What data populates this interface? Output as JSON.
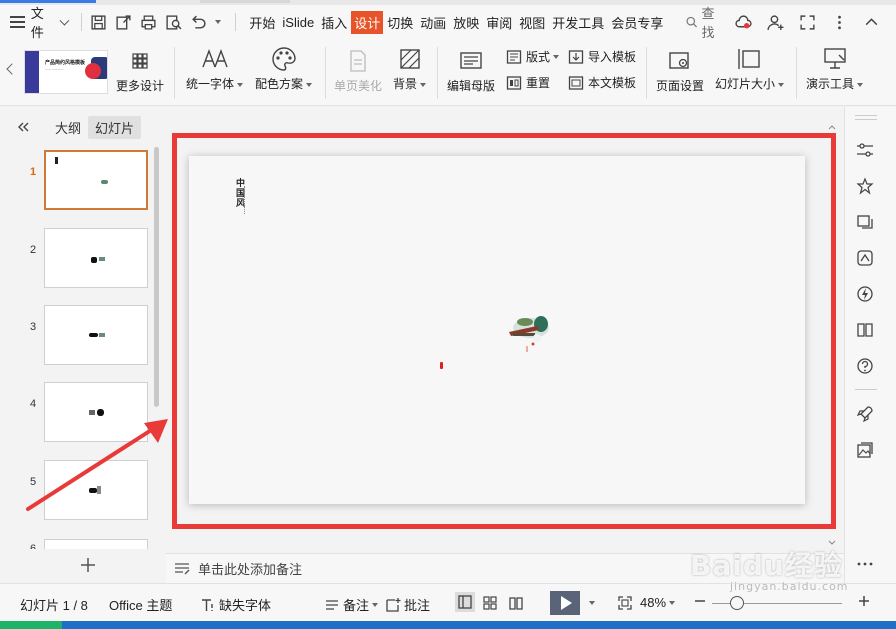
{
  "menu": {
    "file_label": "文件",
    "tabs": [
      {
        "label": "开始",
        "active": false
      },
      {
        "label": "iSlide",
        "active": false
      },
      {
        "label": "插入",
        "active": false
      },
      {
        "label": "设计",
        "active": true
      },
      {
        "label": "切换",
        "active": false
      },
      {
        "label": "动画",
        "active": false
      },
      {
        "label": "放映",
        "active": false
      },
      {
        "label": "审阅",
        "active": false
      },
      {
        "label": "视图",
        "active": false
      },
      {
        "label": "开发工具",
        "active": false
      },
      {
        "label": "会员专享",
        "active": false
      }
    ],
    "search_label": "查找"
  },
  "ribbon": {
    "design_thumb_title": "产品简约风格模板",
    "more_design": "更多设计",
    "unify_font": "统一字体",
    "color_scheme": "配色方案",
    "single_page_beautify": "单页美化",
    "background": "背景",
    "edit_master": "编辑母版",
    "layout": "版式",
    "reset": "重置",
    "import_template": "导入模板",
    "this_template": "本文模板",
    "page_setup": "页面设置",
    "slide_size": "幻灯片大小",
    "presenter_tools": "演示工具"
  },
  "left_panel": {
    "outline_tab": "大纲",
    "slides_tab": "幻灯片",
    "slides": [
      {
        "num": "1",
        "selected": true
      },
      {
        "num": "2",
        "selected": false
      },
      {
        "num": "3",
        "selected": false
      },
      {
        "num": "4",
        "selected": false
      },
      {
        "num": "5",
        "selected": false
      },
      {
        "num": "6",
        "selected": false
      }
    ]
  },
  "slide": {
    "title_vertical": "中国风"
  },
  "notes": {
    "placeholder": "单击此处添加备注"
  },
  "status": {
    "slide_counter": "幻灯片 1 / 8",
    "theme": "Office 主题",
    "missing_font": "缺失字体",
    "notes": "备注",
    "comments": "批注",
    "zoom": "48%"
  },
  "watermark": {
    "brand": "Baidu经验",
    "url": "jingyan.baidu.com"
  },
  "colors": {
    "accent_tab": "#e8542a",
    "red_frame": "#e93a3a",
    "selected_thumb": "#d07a3a",
    "play_button": "#5a6478"
  }
}
